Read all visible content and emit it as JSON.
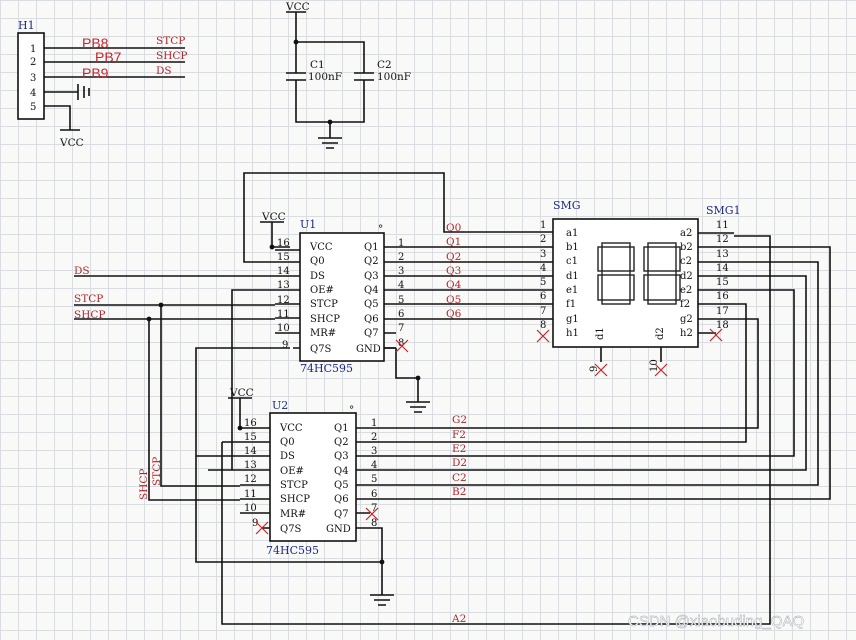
{
  "header_h1": {
    "ref": "H1",
    "pins": [
      "1",
      "2",
      "3",
      "4",
      "5"
    ],
    "ports": [
      "PB8",
      "PB7",
      "PB9"
    ],
    "nets": [
      "STCP",
      "SHCP",
      "DS"
    ],
    "power": "VCC"
  },
  "capacitors": {
    "power": "VCC",
    "c1": {
      "ref": "C1",
      "value": "100nF"
    },
    "c2": {
      "ref": "C2",
      "value": "100nF"
    }
  },
  "u1": {
    "ref": "U1",
    "part": "74HC595",
    "power": "VCC",
    "left_pins": [
      {
        "num": "16",
        "name": "VCC"
      },
      {
        "num": "15",
        "name": "Q0"
      },
      {
        "num": "14",
        "name": "DS"
      },
      {
        "num": "13",
        "name": "OE#"
      },
      {
        "num": "12",
        "name": "STCP"
      },
      {
        "num": "11",
        "name": "SHCP"
      },
      {
        "num": "10",
        "name": "MR#"
      },
      {
        "num": "9",
        "name": "Q7S"
      }
    ],
    "right_pins": [
      {
        "num": "1",
        "name": "Q1"
      },
      {
        "num": "2",
        "name": "Q2"
      },
      {
        "num": "3",
        "name": "Q3"
      },
      {
        "num": "4",
        "name": "Q4"
      },
      {
        "num": "5",
        "name": "Q5"
      },
      {
        "num": "6",
        "name": "Q6"
      },
      {
        "num": "7",
        "name": "Q7"
      },
      {
        "num": "8",
        "name": "GND"
      }
    ],
    "out_nets": [
      "Q0",
      "Q1",
      "Q2",
      "Q3",
      "Q4",
      "Q5",
      "Q6"
    ],
    "in_nets": [
      "DS",
      "STCP",
      "SHCP"
    ]
  },
  "u2": {
    "ref": "U2",
    "part": "74HC595",
    "power": "VCC",
    "left_pins": [
      {
        "num": "16",
        "name": "VCC"
      },
      {
        "num": "15",
        "name": "Q0"
      },
      {
        "num": "14",
        "name": "DS"
      },
      {
        "num": "13",
        "name": "OE#"
      },
      {
        "num": "12",
        "name": "STCP"
      },
      {
        "num": "11",
        "name": "SHCP"
      },
      {
        "num": "10",
        "name": "MR#"
      },
      {
        "num": "9",
        "name": "Q7S"
      }
    ],
    "right_pins": [
      {
        "num": "1",
        "name": "Q1"
      },
      {
        "num": "2",
        "name": "Q2"
      },
      {
        "num": "3",
        "name": "Q3"
      },
      {
        "num": "4",
        "name": "Q4"
      },
      {
        "num": "5",
        "name": "Q5"
      },
      {
        "num": "6",
        "name": "Q6"
      },
      {
        "num": "7",
        "name": "Q7"
      },
      {
        "num": "8",
        "name": "GND"
      }
    ],
    "out_nets": [
      "G2",
      "F2",
      "E2",
      "D2",
      "C2",
      "B2"
    ],
    "vertical_nets": [
      "SHCP",
      "STCP"
    ],
    "bottom_net": "A2"
  },
  "smg": {
    "title": "SMG",
    "ref": "SMG1",
    "left_pins": [
      {
        "num": "1",
        "name": "a1"
      },
      {
        "num": "2",
        "name": "b1"
      },
      {
        "num": "3",
        "name": "c1"
      },
      {
        "num": "4",
        "name": "d1"
      },
      {
        "num": "5",
        "name": "e1"
      },
      {
        "num": "6",
        "name": "f1"
      },
      {
        "num": "7",
        "name": "g1"
      },
      {
        "num": "8",
        "name": "h1"
      }
    ],
    "right_pins": [
      {
        "num": "11",
        "name": "a2"
      },
      {
        "num": "12",
        "name": "b2"
      },
      {
        "num": "13",
        "name": "c2"
      },
      {
        "num": "14",
        "name": "d2"
      },
      {
        "num": "15",
        "name": "e2"
      },
      {
        "num": "16",
        "name": "f2"
      },
      {
        "num": "17",
        "name": "g2"
      },
      {
        "num": "18",
        "name": "h2"
      }
    ],
    "commons": [
      {
        "name": "d1",
        "num": "9"
      },
      {
        "name": "d2",
        "num": "10"
      }
    ]
  },
  "watermark": "CSDN @xiaobuding_QAQ"
}
